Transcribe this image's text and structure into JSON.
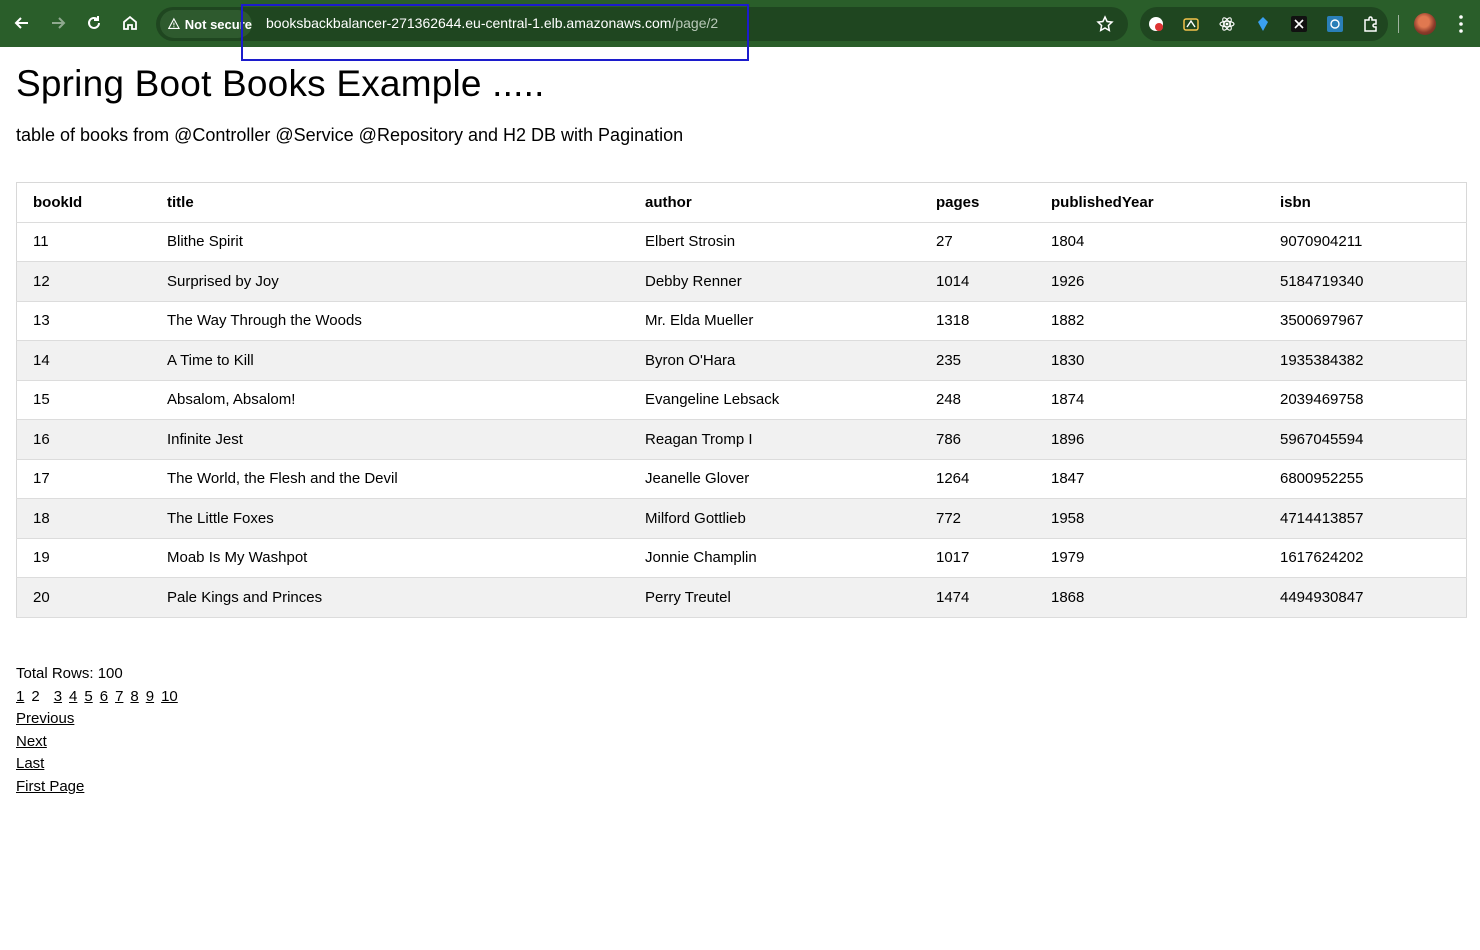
{
  "browser": {
    "security_label": "Not secure",
    "url_host": "booksbackbalancer-271362644.eu-central-1.elb.amazonaws.com",
    "url_path": "/page/2"
  },
  "page": {
    "title": "Spring Boot Books Example .....",
    "subtitle": "table of books from @Controller @Service @Repository and H2 DB with Pagination"
  },
  "table": {
    "headers": [
      "bookId",
      "title",
      "author",
      "pages",
      "publishedYear",
      "isbn"
    ],
    "rows": [
      [
        "11",
        "Blithe Spirit",
        "Elbert Strosin",
        "27",
        "1804",
        "9070904211"
      ],
      [
        "12",
        "Surprised by Joy",
        "Debby Renner",
        "1014",
        "1926",
        "5184719340"
      ],
      [
        "13",
        "The Way Through the Woods",
        "Mr. Elda Mueller",
        "1318",
        "1882",
        "3500697967"
      ],
      [
        "14",
        "A Time to Kill",
        "Byron O'Hara",
        "235",
        "1830",
        "1935384382"
      ],
      [
        "15",
        "Absalom, Absalom!",
        "Evangeline Lebsack",
        "248",
        "1874",
        "2039469758"
      ],
      [
        "16",
        "Infinite Jest",
        "Reagan Tromp I",
        "786",
        "1896",
        "5967045594"
      ],
      [
        "17",
        "The World, the Flesh and the Devil",
        "Jeanelle Glover",
        "1264",
        "1847",
        "6800952255"
      ],
      [
        "18",
        "The Little Foxes",
        "Milford Gottlieb",
        "772",
        "1958",
        "4714413857"
      ],
      [
        "19",
        "Moab Is My Washpot",
        "Jonnie Champlin",
        "1017",
        "1979",
        "1617624202"
      ],
      [
        "20",
        "Pale Kings and Princes",
        "Perry Treutel",
        "1474",
        "1868",
        "4494930847"
      ]
    ]
  },
  "pagination": {
    "total_rows": "Total Rows: 100",
    "pages": [
      "1",
      "2",
      "3",
      "4",
      "5",
      "6",
      "7",
      "8",
      "9",
      "10"
    ],
    "current_page": "2",
    "previous": "Previous",
    "next": "Next",
    "last": "Last",
    "first": "First Page"
  }
}
